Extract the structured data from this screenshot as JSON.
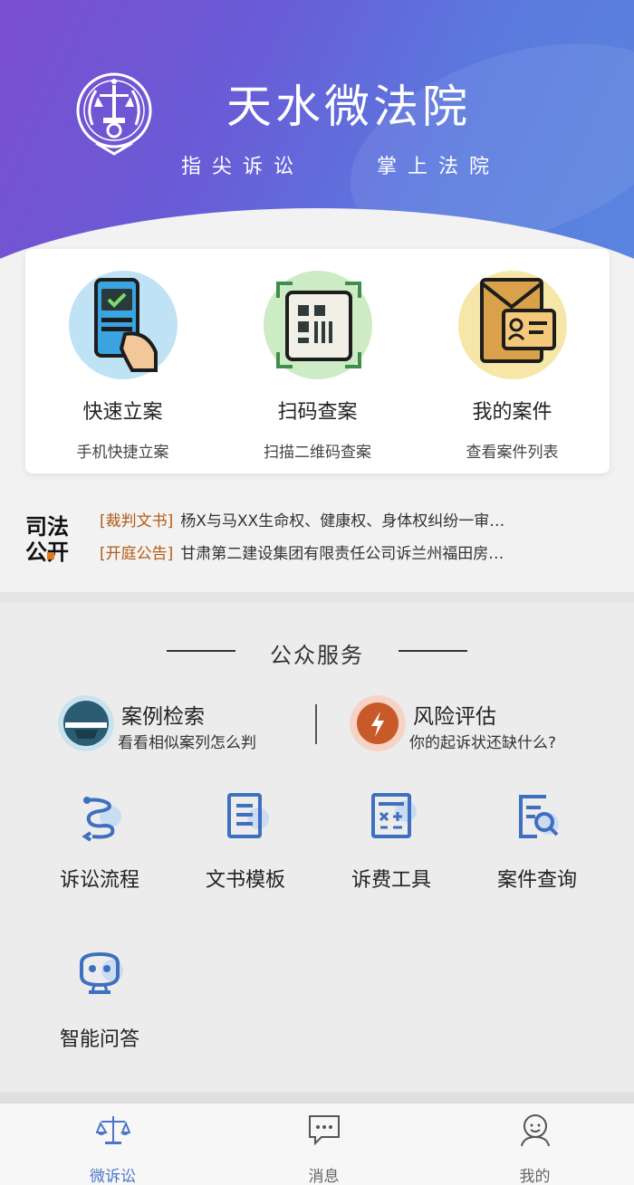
{
  "header": {
    "title": "天水微法院",
    "slogan_left": "指尖诉讼",
    "slogan_right": "掌上法院"
  },
  "quick_actions": [
    {
      "title": "快速立案",
      "subtitle": "手机快捷立案",
      "icon": "phone-check-icon",
      "color": "#bfe3f5"
    },
    {
      "title": "扫码查案",
      "subtitle": "扫描二维码查案",
      "icon": "qr-scan-icon",
      "color": "#cdebc4"
    },
    {
      "title": "我的案件",
      "subtitle": "查看案件列表",
      "icon": "case-folder-icon",
      "color": "#f6e6a8"
    }
  ],
  "judicial_open": {
    "logo_text_top": "司法",
    "logo_text_bottom": "公开",
    "news": [
      {
        "tag": "[裁判文书]",
        "text": "杨X与马XX生命权、健康权、身体权纠纷一审…"
      },
      {
        "tag": "[开庭公告]",
        "text": "甘肃第二建设集团有限责任公司诉兰州福田房…"
      }
    ]
  },
  "public_service": {
    "title": "公众服务",
    "features": [
      {
        "title": "案例检索",
        "subtitle": "看看相似案列怎么判",
        "icon": "case-search-icon"
      },
      {
        "title": "风险评估",
        "subtitle": "你的起诉状还缺什么?",
        "icon": "lightning-icon"
      }
    ],
    "tools": [
      {
        "label": "诉讼流程",
        "icon": "process-icon"
      },
      {
        "label": "文书模板",
        "icon": "document-template-icon"
      },
      {
        "label": "诉费工具",
        "icon": "calculator-icon"
      },
      {
        "label": "案件查询",
        "icon": "case-query-icon"
      },
      {
        "label": "智能问答",
        "icon": "robot-icon"
      }
    ]
  },
  "bottom_nav": [
    {
      "label": "微诉讼",
      "icon": "scales-icon",
      "active": true
    },
    {
      "label": "消息",
      "icon": "message-icon",
      "active": false
    },
    {
      "label": "我的",
      "icon": "profile-icon",
      "active": false
    }
  ],
  "colors": {
    "accent": "#4a76c8",
    "header_start": "#7a4fcf",
    "header_end": "#5a86df",
    "tag": "#b45a14"
  }
}
